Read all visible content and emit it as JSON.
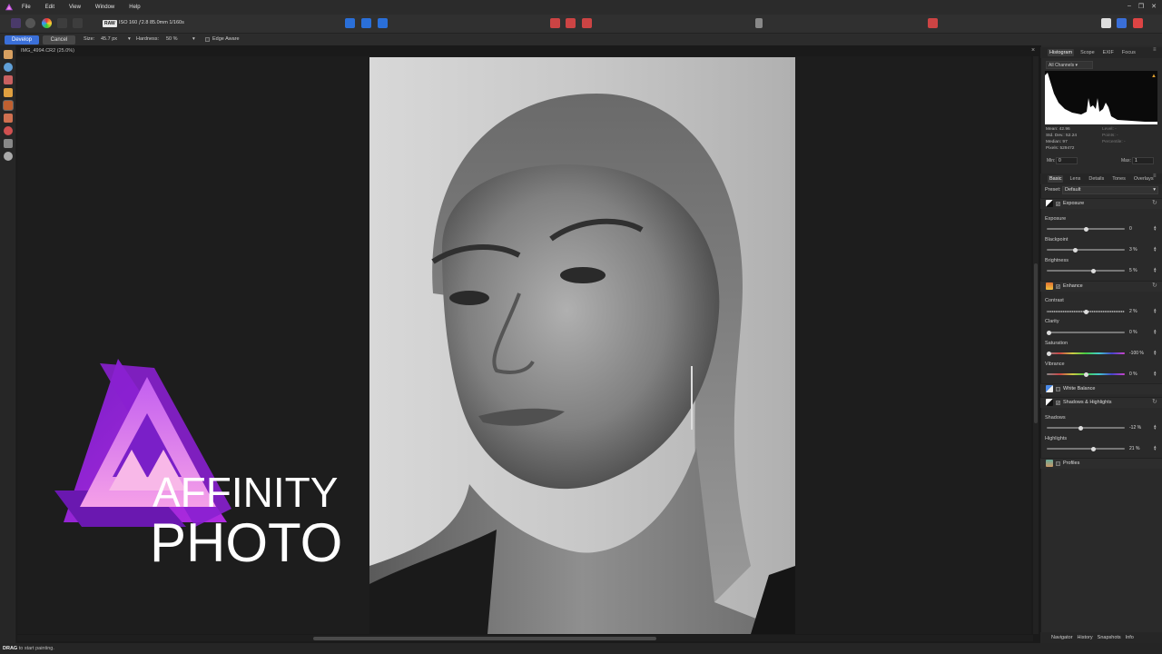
{
  "menubar": {
    "items": [
      "File",
      "Edit",
      "View",
      "Window",
      "Help"
    ]
  },
  "toolbar": {
    "raw_badge": "RAW",
    "raw_info": "ISO 160 ƒ2.8 85.0mm 1/160s"
  },
  "context_bar": {
    "develop_label": "Develop",
    "cancel_label": "Cancel",
    "size_label": "Size:",
    "size_value": "45.7 px",
    "hardness_label": "Hardness:",
    "hardness_value": "50 %",
    "edge_aware_label": "Edge Aware"
  },
  "document": {
    "tab_title": "IMG_4994.CR2 (25.0%)"
  },
  "logo": {
    "line1": "AFFINITY",
    "line2": "PHOTO"
  },
  "right_panel": {
    "top_tabs": [
      "Histogram",
      "Scope",
      "EXIF",
      "Focus"
    ],
    "channel_select": "All Channels",
    "stats": {
      "mean": "Mean: 42.96",
      "std_dev": "Std. Dev.: 52.24",
      "median": "Median: 97",
      "pixels": "Pixels: 529472",
      "level": "Level: -",
      "points": "Points: -",
      "percentile": "Percentile: -"
    },
    "min_label": "Min:",
    "min_value": "0",
    "max_label": "Max:",
    "max_value": "1",
    "develop_tabs": [
      "Basic",
      "Lens",
      "Details",
      "Tones",
      "Overlays"
    ],
    "preset_label": "Preset:",
    "preset_value": "Default",
    "sections": {
      "exposure": "Exposure",
      "enhance": "Enhance",
      "white_balance": "White Balance",
      "shadows_highlights": "Shadows & Highlights",
      "profiles": "Profiles"
    },
    "sliders": {
      "exposure": {
        "label": "Exposure",
        "value": "0",
        "level": 0.5
      },
      "blackpoint": {
        "label": "Blackpoint",
        "value": "3 %",
        "level": 0.37
      },
      "brightness": {
        "label": "Brightness",
        "value": "5 %",
        "level": 0.6
      },
      "contrast": {
        "label": "Contrast",
        "value": "2 %",
        "level": 0.51
      },
      "clarity": {
        "label": "Clarity",
        "value": "0 %",
        "level": 0.03
      },
      "saturation": {
        "label": "Saturation",
        "value": "-100 %",
        "level": 0.03
      },
      "vibrance": {
        "label": "Vibrance",
        "value": "0 %",
        "level": 0.5
      },
      "shadows": {
        "label": "Shadows",
        "value": "-12 %",
        "level": 0.44
      },
      "highlights": {
        "label": "Highlights",
        "value": "21 %",
        "level": 0.6
      }
    },
    "bottom_tabs": [
      "Navigator",
      "History",
      "Snapshots",
      "Info"
    ]
  },
  "statusbar": {
    "action": "DRAG",
    "hint": "to start painting."
  },
  "colors": {
    "accent": "#3a6fd8",
    "logo_purple": "#8a2be2",
    "logo_pink": "#e040fb"
  }
}
